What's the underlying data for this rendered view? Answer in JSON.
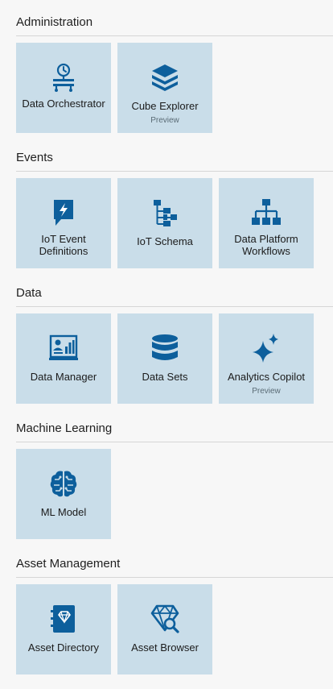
{
  "sections": [
    {
      "title": "Administration",
      "tiles": [
        {
          "label": "Data Orchestrator",
          "sub": "",
          "icon": "orchestrator-icon"
        },
        {
          "label": "Cube Explorer",
          "sub": "Preview",
          "icon": "cube-layers-icon"
        }
      ]
    },
    {
      "title": "Events",
      "tiles": [
        {
          "label": "IoT Event Definitions",
          "sub": "",
          "icon": "event-flag-icon"
        },
        {
          "label": "IoT Schema",
          "sub": "",
          "icon": "schema-tree-icon"
        },
        {
          "label": "Data Platform Workflows",
          "sub": "",
          "icon": "workflow-hierarchy-icon"
        }
      ]
    },
    {
      "title": "Data",
      "tiles": [
        {
          "label": "Data Manager",
          "sub": "",
          "icon": "data-manager-icon"
        },
        {
          "label": "Data Sets",
          "sub": "",
          "icon": "database-icon"
        },
        {
          "label": "Analytics Copilot",
          "sub": "Preview",
          "icon": "sparkle-icon"
        }
      ]
    },
    {
      "title": "Machine Learning",
      "tiles": [
        {
          "label": "ML Model",
          "sub": "",
          "icon": "brain-circuit-icon"
        }
      ]
    },
    {
      "title": "Asset Management",
      "tiles": [
        {
          "label": "Asset Directory",
          "sub": "",
          "icon": "asset-book-icon"
        },
        {
          "label": "Asset Browser",
          "sub": "",
          "icon": "asset-search-icon"
        }
      ]
    }
  ],
  "colors": {
    "tile_bg": "#c9dde9",
    "icon": "#0d5f9c",
    "rule": "#d6d6d6",
    "page_bg": "#f7f7f7"
  }
}
